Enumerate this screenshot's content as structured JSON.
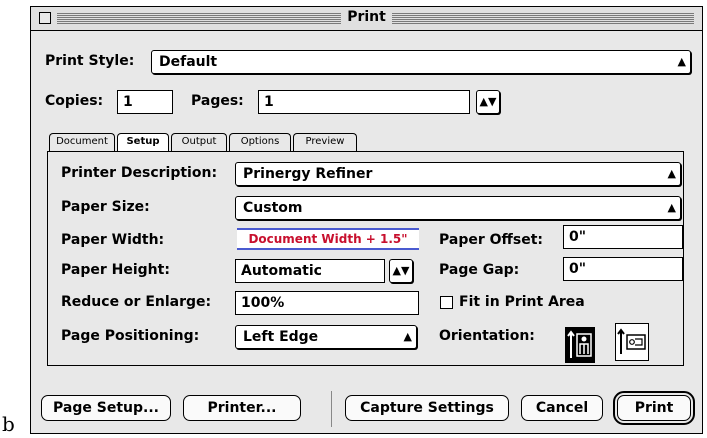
{
  "caption": "b",
  "window": {
    "title": "Print"
  },
  "print_style": {
    "label": "Print Style:",
    "value": "Default"
  },
  "copies": {
    "label": "Copies:",
    "value": "1"
  },
  "pages": {
    "label": "Pages:",
    "value": "1"
  },
  "tabs": [
    {
      "label": "Document",
      "active": false
    },
    {
      "label": "Setup",
      "active": true
    },
    {
      "label": "Output",
      "active": false
    },
    {
      "label": "Options",
      "active": false
    },
    {
      "label": "Preview",
      "active": false
    }
  ],
  "setup": {
    "printer_description": {
      "label": "Printer Description:",
      "value": "Prinergy Refiner"
    },
    "paper_size": {
      "label": "Paper Size:",
      "value": "Custom"
    },
    "paper_width": {
      "label": "Paper Width:",
      "value": "Document Width + 1.5\""
    },
    "paper_offset": {
      "label": "Paper Offset:",
      "value": "0\""
    },
    "paper_height": {
      "label": "Paper Height:",
      "value": "Automatic"
    },
    "page_gap": {
      "label": "Page Gap:",
      "value": "0\""
    },
    "reduce_enlarge": {
      "label": "Reduce or Enlarge:",
      "value": "100%"
    },
    "fit_in_print_area": {
      "label": "Fit in Print Area",
      "checked": false
    },
    "page_positioning": {
      "label": "Page Positioning:",
      "value": "Left Edge"
    },
    "orientation": {
      "label": "Orientation:",
      "selected": "portrait"
    }
  },
  "buttons": {
    "page_setup": "Page Setup...",
    "printer": "Printer...",
    "capture_settings": "Capture Settings",
    "cancel": "Cancel",
    "print": "Print"
  },
  "icons": {
    "popup_arrows": "up-down-arrows-icon",
    "portrait": "portrait-orientation-icon",
    "landscape": "landscape-orientation-icon"
  },
  "colors": {
    "doc_width_text": "#c8102e",
    "doc_width_border": "#4a5ad0"
  }
}
